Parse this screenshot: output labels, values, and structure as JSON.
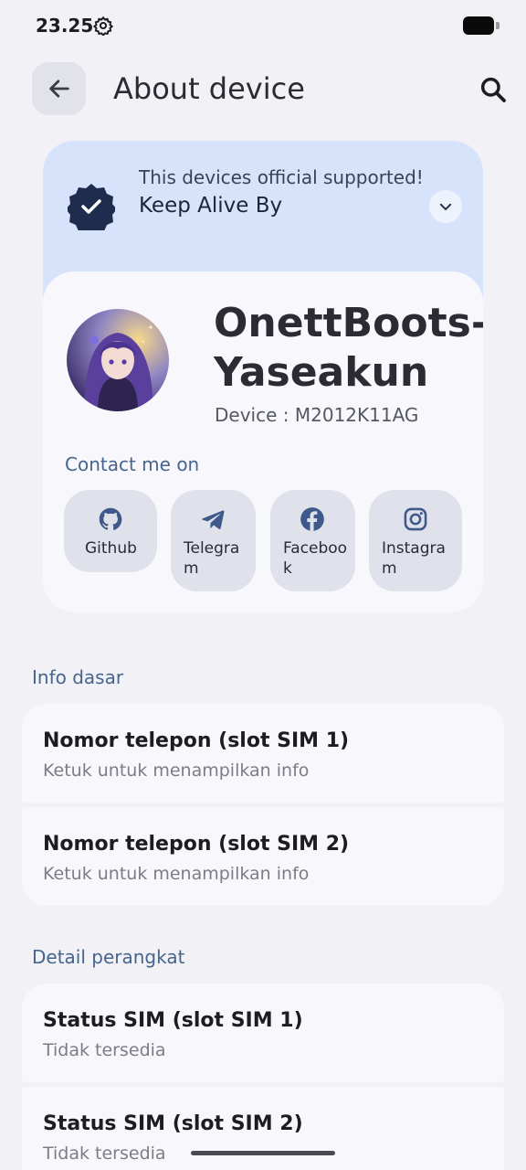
{
  "status_bar": {
    "time": "23.25"
  },
  "header": {
    "title": "About device",
    "back_icon": "arrow-back-icon",
    "search_icon": "search-icon"
  },
  "support": {
    "line1": "This devices official supported!",
    "line2": "Keep Alive By",
    "badge_icon": "verified-badge-icon",
    "expand_icon": "chevron-down-icon"
  },
  "profile": {
    "name": "OnettBoots-Yaseakun",
    "device_label": "Device : ",
    "device_value": "M2012K11AG",
    "contact_label": "Contact me on"
  },
  "socials": [
    {
      "label": "Github",
      "icon": "github-icon"
    },
    {
      "label": "Telegram",
      "icon": "telegram-icon"
    },
    {
      "label": "Facebook",
      "icon": "facebook-icon"
    },
    {
      "label": "Instagram",
      "icon": "instagram-icon"
    }
  ],
  "sections": [
    {
      "label": "Info dasar",
      "items": [
        {
          "title": "Nomor telepon (slot SIM 1)",
          "subtitle": "Ketuk untuk menampilkan info"
        },
        {
          "title": "Nomor telepon (slot SIM 2)",
          "subtitle": "Ketuk untuk menampilkan info"
        }
      ]
    },
    {
      "label": "Detail perangkat",
      "items": [
        {
          "title": "Status SIM (slot SIM 1)",
          "subtitle": "Tidak tersedia"
        },
        {
          "title": "Status SIM (slot SIM 2)",
          "subtitle": "Tidak tersedia"
        }
      ]
    }
  ],
  "colors": {
    "accent": "#46658e",
    "support_card": "#d7e3fb",
    "badge": "#1e2c4e"
  }
}
